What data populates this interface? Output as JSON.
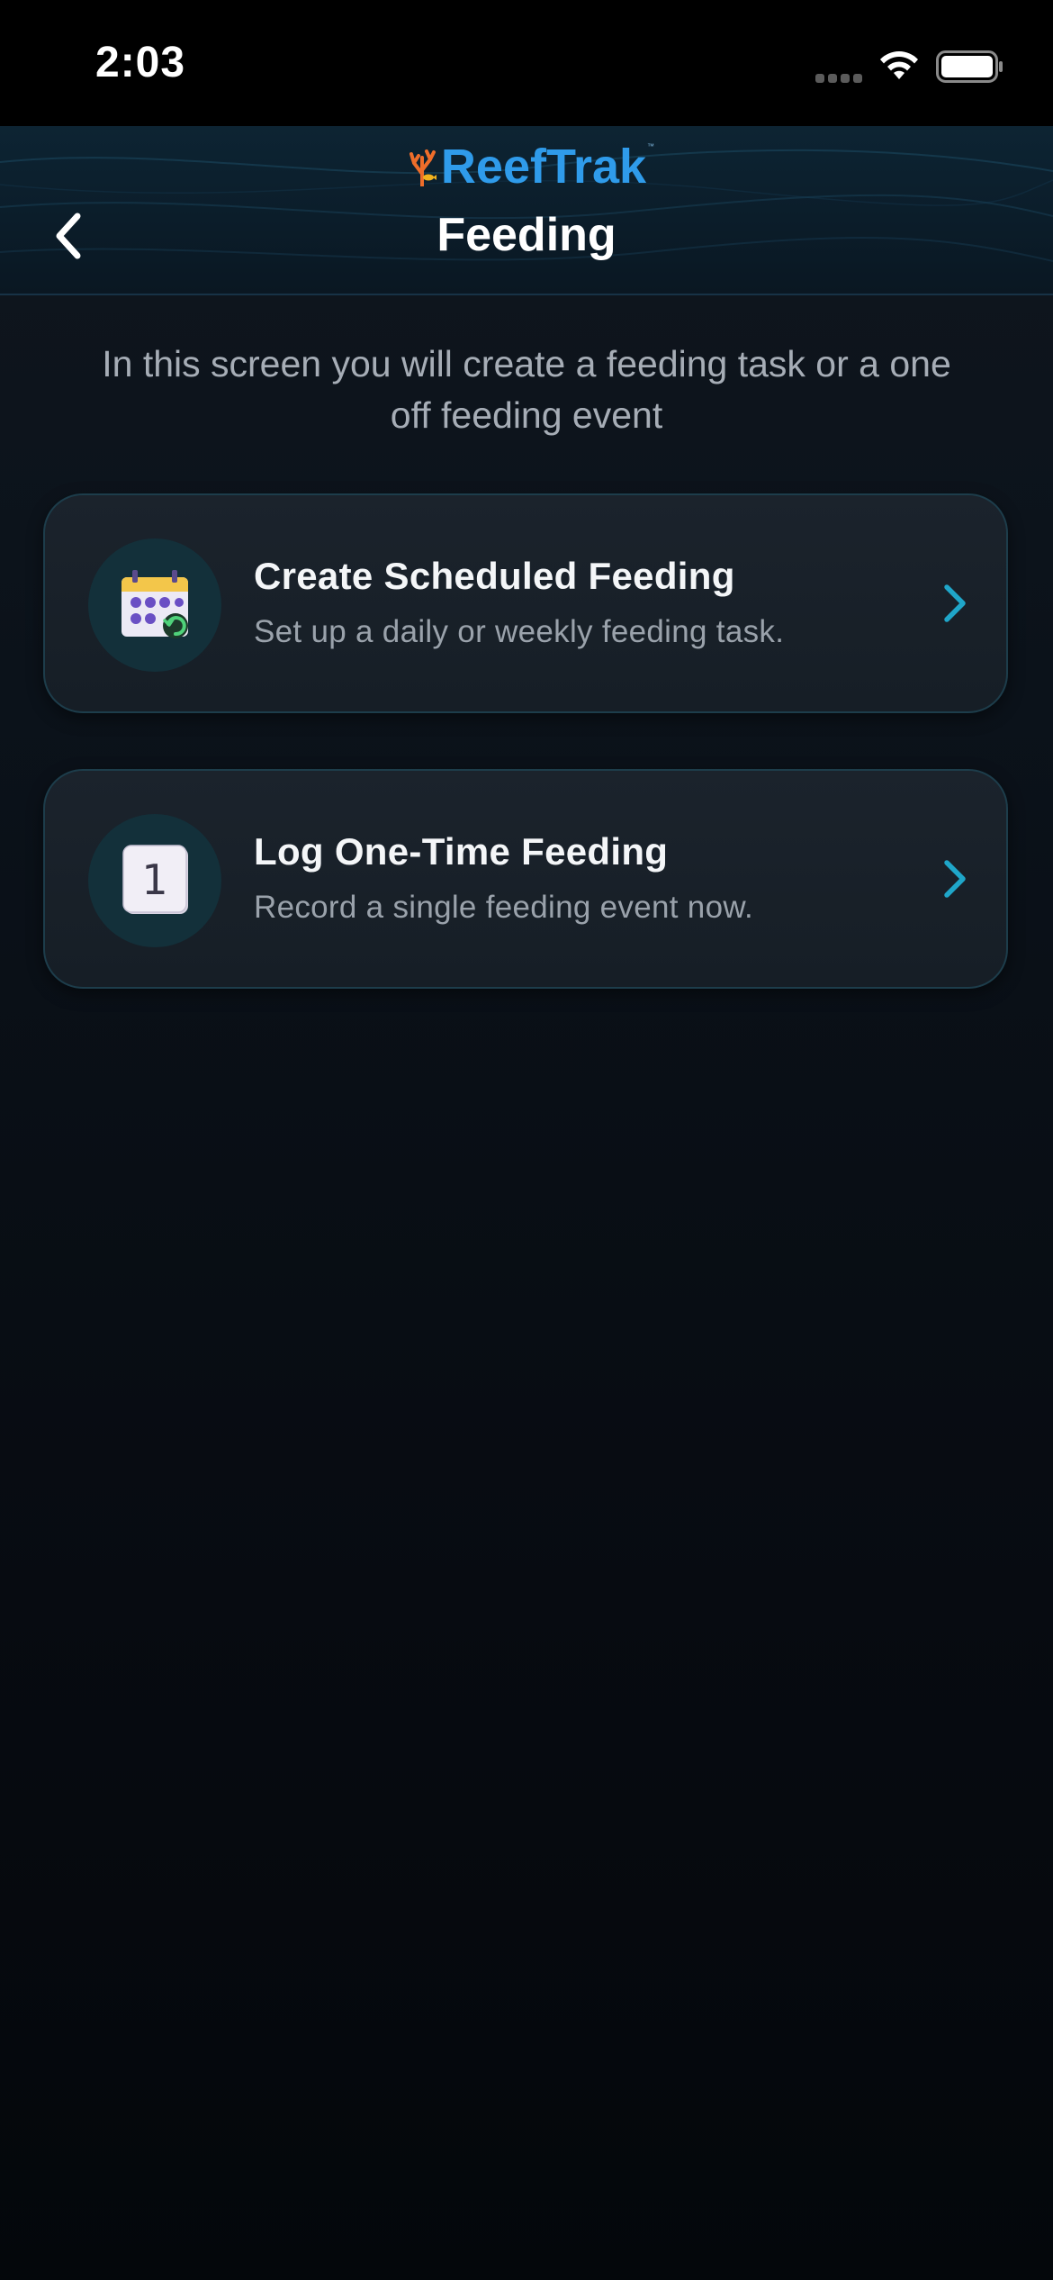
{
  "status_bar": {
    "time": "2:03"
  },
  "header": {
    "logo_text": "ReefTrak",
    "logo_tm": "™",
    "title": "Feeding",
    "back_icon": "chevron-left-icon"
  },
  "intro": {
    "text": "In this screen you will create a feeding task or a one off feeding event"
  },
  "options": [
    {
      "title": "Create Scheduled Feeding",
      "subtitle": "Set up a daily or weekly feeding task.",
      "icon": "calendar-repeat-icon"
    },
    {
      "title": "Log One-Time Feeding",
      "subtitle": "Record a single feeding event now.",
      "icon": "calendar-one-icon",
      "icon_text": "1"
    }
  ],
  "colors": {
    "accent": "#2f9bea",
    "chevron": "#1fa6c9",
    "card_border": "#1d3d4b",
    "background": "#0b121a"
  }
}
